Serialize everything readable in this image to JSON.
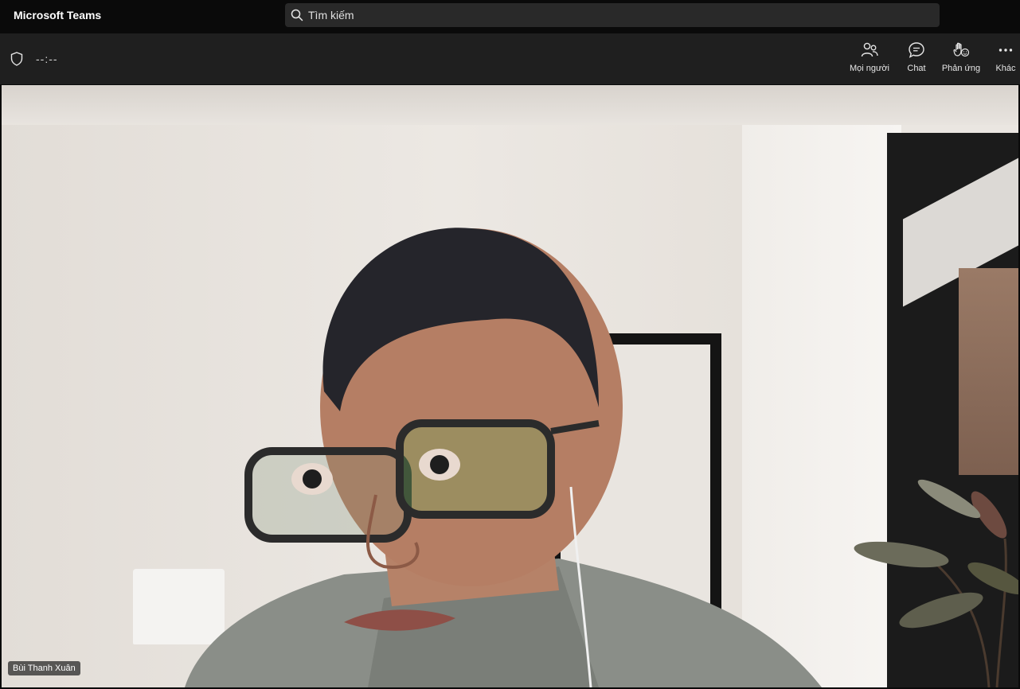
{
  "app": {
    "title": "Microsoft Teams"
  },
  "search": {
    "placeholder": "Tìm kiếm",
    "icon": "search-icon"
  },
  "meeting": {
    "timer": "--:--",
    "toolbar": [
      {
        "id": "people",
        "label": "Mọi người",
        "icon": "people-icon"
      },
      {
        "id": "chat",
        "label": "Chat",
        "icon": "chat-icon"
      },
      {
        "id": "reactions",
        "label": "Phản ứng",
        "icon": "raise-hand-icon"
      },
      {
        "id": "more",
        "label": "Khác",
        "icon": "more-icon"
      }
    ]
  },
  "video": {
    "participant_name": "Bùi Thanh Xuân"
  },
  "colors": {
    "titlebar_bg": "#0a0a0a",
    "toolbar_bg": "#1f1f1f",
    "search_bg": "#292929"
  }
}
